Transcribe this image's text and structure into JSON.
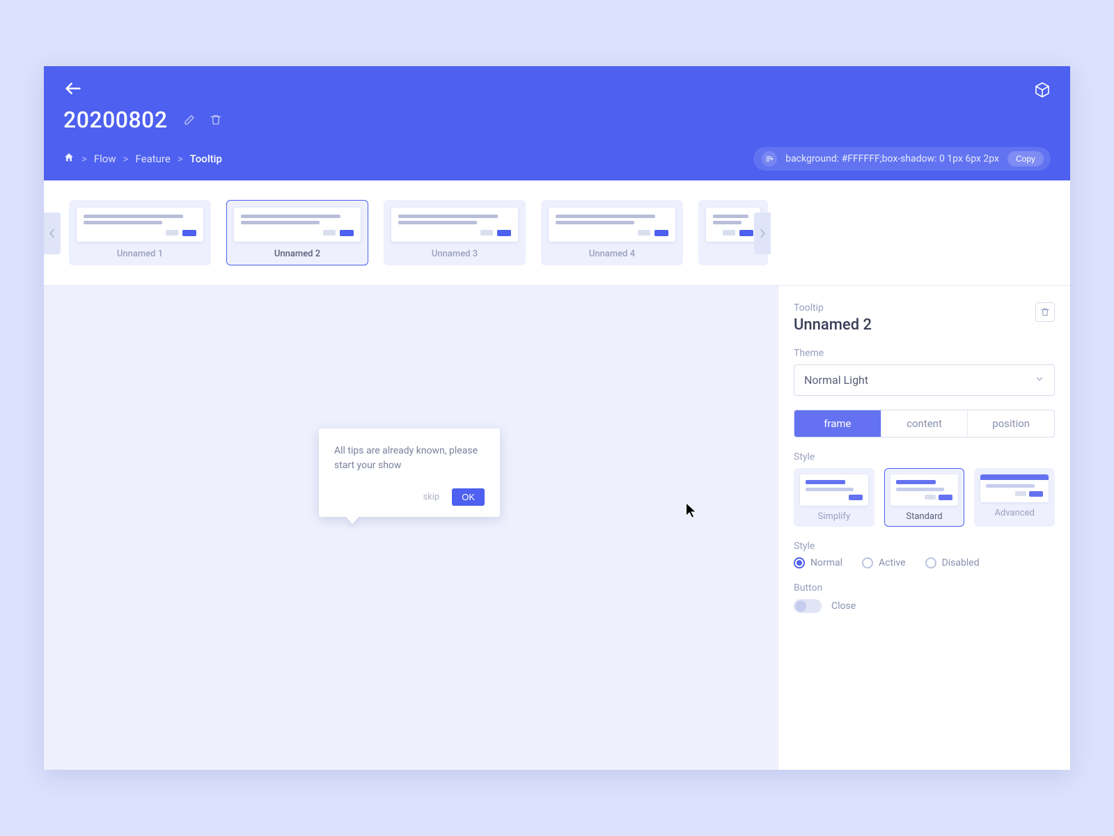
{
  "header": {
    "title": "20200802",
    "breadcrumb": {
      "flow": "Flow",
      "feature": "Feature",
      "current": "Tooltip"
    },
    "css_snippet": "background: #FFFFFF;box-shadow: 0 1px 6px 2px",
    "copy_label": "Copy"
  },
  "thumbs": [
    {
      "label": "Unnamed 1"
    },
    {
      "label": "Unnamed 2"
    },
    {
      "label": "Unnamed 3"
    },
    {
      "label": "Unnamed 4"
    }
  ],
  "tooltip": {
    "text": "All tips are already known, please start your show",
    "skip": "skip",
    "ok": "OK"
  },
  "panel": {
    "eyebrow": "Tooltip",
    "name": "Unnamed 2",
    "theme_label": "Theme",
    "theme_value": "Normal Light",
    "tabs": {
      "frame": "frame",
      "content": "content",
      "position": "position"
    },
    "style_label": "Style",
    "style_cards": {
      "simplify": "Simplify",
      "standard": "Standard",
      "advanced": "Advanced"
    },
    "state_label": "Style",
    "states": {
      "normal": "Normal",
      "active": "Active",
      "disabled": "Disabled"
    },
    "button_label": "Button",
    "close_label": "Close"
  }
}
